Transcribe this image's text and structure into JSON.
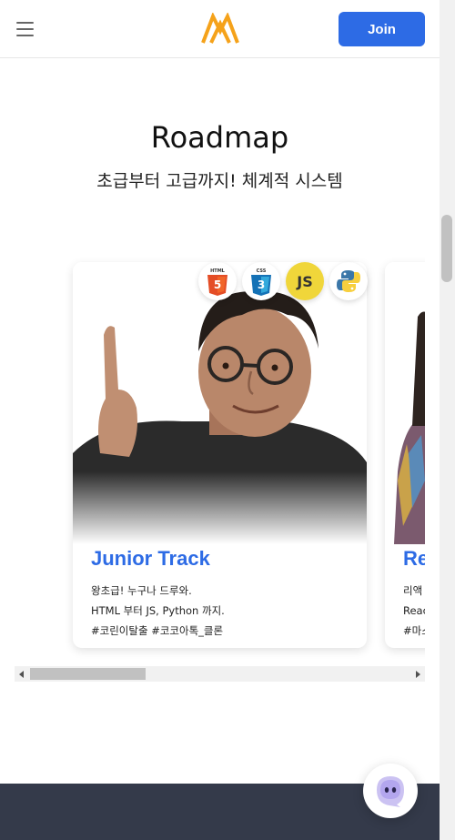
{
  "header": {
    "join_label": "Join",
    "logo_name": "logo-m-icon",
    "menu_icon": "hamburger-icon",
    "accent_color": "#2d6be5"
  },
  "section": {
    "title": "Roadmap",
    "subtitle": "초급부터 고급까지! 체계적 시스템"
  },
  "cards": [
    {
      "title": "Junior Track",
      "desc": [
        "왕초급! 누구나 드루와.",
        "HTML 부터 JS, Python 까지.",
        "#코린이탈출 #코코아톡_클론"
      ],
      "tech_icons": [
        "html5-icon",
        "css3-icon",
        "js-icon",
        "python-icon"
      ],
      "tech_labels": {
        "html": "HTML",
        "css": "CSS",
        "js": "JS"
      }
    },
    {
      "title": "Re",
      "desc": [
        "리액",
        "Reac",
        "#마스"
      ]
    }
  ],
  "colors": {
    "footer": "#343a4a",
    "title_blue": "#2d6be5"
  }
}
